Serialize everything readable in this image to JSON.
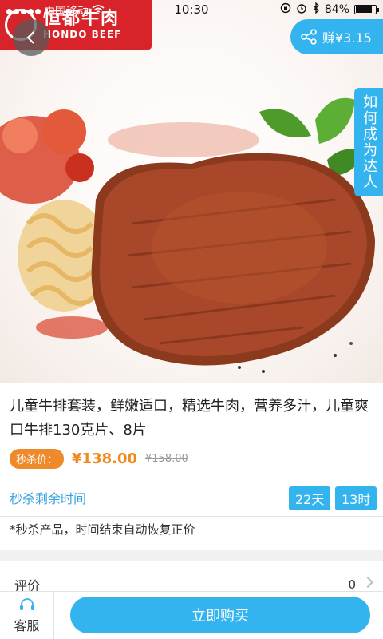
{
  "status_bar": {
    "carrier": "中国移动",
    "time": "10:30",
    "battery": "84%",
    "battery_level": 0.84
  },
  "brand": {
    "name_cn": "恒都牛肉",
    "name_en": "HONDO BEEF"
  },
  "header": {
    "earn_label": "赚¥3.15",
    "daren_tab_label": "如何成为达人"
  },
  "product": {
    "title": "儿童牛排套装，鲜嫩适口，精选牛肉，营养多汁，儿童爽口牛排130克片、8片",
    "sale_tag": "秒杀价：",
    "price_now": "¥138.00",
    "price_old": "¥158.00"
  },
  "countdown": {
    "label": "秒杀剩余时间",
    "days": "22天",
    "hours": "13时"
  },
  "notice": "*秒杀产品，时间结束自动恢复正价",
  "review": {
    "label": "评价",
    "count": "0"
  },
  "bottom_bar": {
    "service_label": "客服",
    "buy_label": "立即购买"
  },
  "colors": {
    "accent": "#34b4ef",
    "price": "#f08a1c",
    "sale_tag": "#ef8a2b",
    "brand": "#d8232a"
  },
  "icons": {
    "back": "chevron-left-icon",
    "share": "share-icon",
    "service": "headset-icon",
    "review_more": "chevron-right-icon"
  }
}
